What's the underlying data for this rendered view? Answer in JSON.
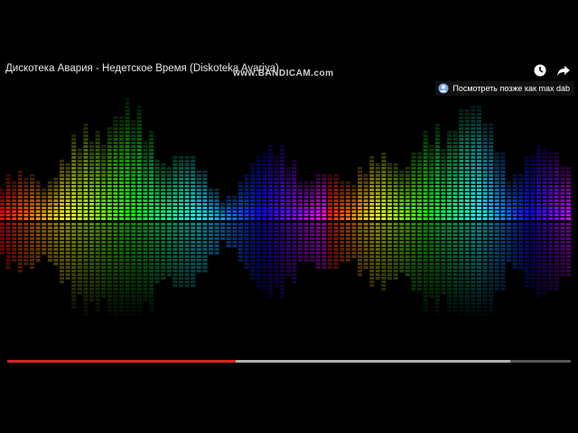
{
  "video": {
    "title": "Дискотека Авария - Недетское Время (Diskoteka Avariya)",
    "watermark": "www.BANDICAM.com",
    "watch_later_label": "Посмотреть позже как max dab"
  },
  "playback": {
    "played_fraction": 0.406,
    "buffered_fraction": 0.893
  },
  "icons": {
    "watch_later": "clock-icon",
    "share": "share-icon",
    "banner": "user-avatar-icon"
  },
  "colors": {
    "progress_played": "#d0281e",
    "progress_buffer": "#b0b0b0",
    "progress_track": "#555555",
    "background": "#000000"
  }
}
